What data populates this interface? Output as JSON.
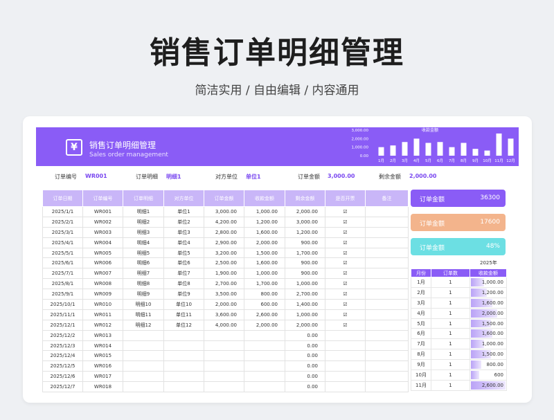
{
  "page": {
    "title": "销售订单明细管理",
    "subtitle": "简洁实用 / 自由编辑 / 内容通用"
  },
  "banner": {
    "title": "销售订单明细管理",
    "subtitle": "Sales order management",
    "logo_icon": "yen-document-icon",
    "chart_title": "收款金额"
  },
  "chart_data": {
    "type": "bar",
    "title": "收款金额",
    "categories": [
      "1月",
      "2月",
      "3月",
      "4月",
      "5月",
      "6月",
      "7月",
      "8月",
      "9月",
      "10月",
      "11月",
      "12月"
    ],
    "values": [
      1000,
      1200,
      1600,
      2000,
      1500,
      1600,
      1000,
      1500,
      800,
      600,
      2600,
      2000
    ],
    "y_ticks": [
      "3,000.00",
      "2,000.00",
      "1,000.00",
      "0.00"
    ],
    "ylim": [
      0,
      3000
    ],
    "bar_color": "#ffffff"
  },
  "info": [
    {
      "label": "订单编号",
      "value": "WR001"
    },
    {
      "label": "订单明细",
      "value": "明细1"
    },
    {
      "label": "对方单位",
      "value": "单位1"
    },
    {
      "label": "订单金额",
      "value": "3,000.00"
    },
    {
      "label": "剩余金额",
      "value": "2,000.00"
    }
  ],
  "table": {
    "headers": [
      "订单日期",
      "订单编号",
      "订单明细",
      "对方单位",
      "订单金额",
      "收款金额",
      "剩余金额",
      "是否开票",
      "备注"
    ],
    "rows": [
      [
        "2025/1/1",
        "WR001",
        "明细1",
        "单位1",
        "3,000.00",
        "1,000.00",
        "2,000.00",
        "☑",
        ""
      ],
      [
        "2025/2/1",
        "WR002",
        "明细2",
        "单位2",
        "4,200.00",
        "1,200.00",
        "3,000.00",
        "☑",
        ""
      ],
      [
        "2025/3/1",
        "WR003",
        "明细3",
        "单位3",
        "2,800.00",
        "1,600.00",
        "1,200.00",
        "☑",
        ""
      ],
      [
        "2025/4/1",
        "WR004",
        "明细4",
        "单位4",
        "2,900.00",
        "2,000.00",
        "900.00",
        "☑",
        ""
      ],
      [
        "2025/5/1",
        "WR005",
        "明细5",
        "单位5",
        "3,200.00",
        "1,500.00",
        "1,700.00",
        "☑",
        ""
      ],
      [
        "2025/6/1",
        "WR006",
        "明细6",
        "单位6",
        "2,500.00",
        "1,600.00",
        "900.00",
        "☑",
        ""
      ],
      [
        "2025/7/1",
        "WR007",
        "明细7",
        "单位7",
        "1,900.00",
        "1,000.00",
        "900.00",
        "☑",
        ""
      ],
      [
        "2025/8/1",
        "WR008",
        "明细8",
        "单位8",
        "2,700.00",
        "1,700.00",
        "1,000.00",
        "☑",
        ""
      ],
      [
        "2025/9/1",
        "WR009",
        "明细9",
        "单位9",
        "3,500.00",
        "800.00",
        "2,700.00",
        "☑",
        ""
      ],
      [
        "2025/10/1",
        "WR010",
        "明细10",
        "单位10",
        "2,000.00",
        "600.00",
        "1,400.00",
        "☑",
        ""
      ],
      [
        "2025/11/1",
        "WR011",
        "明细11",
        "单位11",
        "3,600.00",
        "2,600.00",
        "1,000.00",
        "☑",
        ""
      ],
      [
        "2025/12/1",
        "WR012",
        "明细12",
        "单位12",
        "4,000.00",
        "2,000.00",
        "2,000.00",
        "☑",
        ""
      ],
      [
        "2025/12/2",
        "WR013",
        "",
        "",
        "",
        "",
        "0.00",
        "",
        ""
      ],
      [
        "2025/12/3",
        "WR014",
        "",
        "",
        "",
        "",
        "0.00",
        "",
        ""
      ],
      [
        "2025/12/4",
        "WR015",
        "",
        "",
        "",
        "",
        "0.00",
        "",
        ""
      ],
      [
        "2025/12/5",
        "WR016",
        "",
        "",
        "",
        "",
        "0.00",
        "",
        ""
      ],
      [
        "2025/12/6",
        "WR017",
        "",
        "",
        "",
        "",
        "0.00",
        "",
        ""
      ],
      [
        "2025/12/7",
        "WR018",
        "",
        "",
        "",
        "",
        "0.00",
        "",
        ""
      ]
    ]
  },
  "summary": [
    {
      "label": "订单金额",
      "value": "36300",
      "color": "#8a5cf6"
    },
    {
      "label": "订单金额",
      "value": "17600",
      "color": "#f3b48c"
    },
    {
      "label": "订单金额",
      "value": "48%",
      "color": "#6cdfe3"
    }
  ],
  "monthly": {
    "year": "2025年",
    "headers": [
      "月份",
      "订单数",
      "收款金额"
    ],
    "max": 2600,
    "rows": [
      {
        "month": "1月",
        "count": "1",
        "amount": "1,000.00",
        "value": 1000
      },
      {
        "month": "2月",
        "count": "1",
        "amount": "1,200.00",
        "value": 1200
      },
      {
        "month": "3月",
        "count": "1",
        "amount": "1,600.00",
        "value": 1600
      },
      {
        "month": "4月",
        "count": "1",
        "amount": "2,000.00",
        "value": 2000
      },
      {
        "month": "5月",
        "count": "1",
        "amount": "1,500.00",
        "value": 1500
      },
      {
        "month": "6月",
        "count": "1",
        "amount": "1,600.00",
        "value": 1600
      },
      {
        "month": "7月",
        "count": "1",
        "amount": "1,000.00",
        "value": 1000
      },
      {
        "month": "8月",
        "count": "1",
        "amount": "1,500.00",
        "value": 1500
      },
      {
        "month": "9月",
        "count": "1",
        "amount": "800.00",
        "value": 800
      },
      {
        "month": "10月",
        "count": "1",
        "amount": "600",
        "value": 600
      },
      {
        "month": "11月",
        "count": "1",
        "amount": "2,600.00",
        "value": 2600
      }
    ]
  }
}
